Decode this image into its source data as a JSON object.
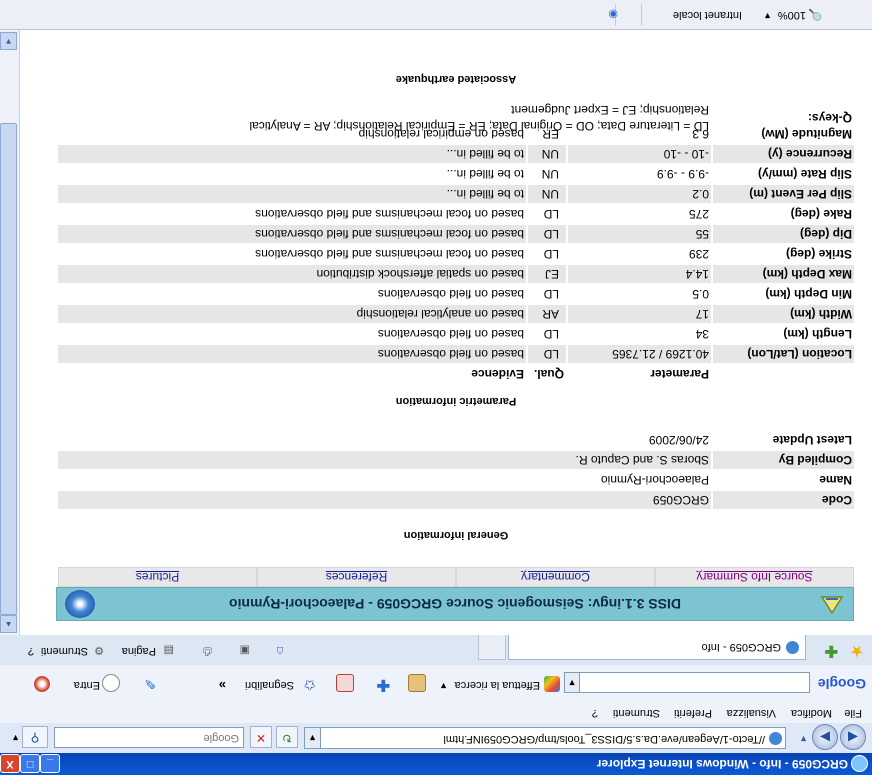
{
  "window": {
    "title": "GRCG059 - Info - Windows Internet Explorer",
    "minimize": "_",
    "maximize": "□",
    "close": "X"
  },
  "address": {
    "url": "//Tecto-1/Aegean/eve.Da.s.5/DISS3_Tools/tmp/GRCG059INF.html",
    "search_placeholder": "Google",
    "go_symbol": "↻",
    "stop_symbol": "✕"
  },
  "menu": [
    "File",
    "Modifica",
    "Visualizza",
    "Preferiti",
    "Strumenti",
    "?"
  ],
  "google_toolbar": {
    "logo": "Google",
    "search_button": "Effettua la ricerca",
    "bookmarks_label": "Segnalibri",
    "more": "»",
    "signin": "Entra"
  },
  "tabs": {
    "active_title": "GRCG059 - Info",
    "commands": {
      "page": "Pagina",
      "tools": "Strumenti"
    }
  },
  "page": {
    "banner_title": "DISS 3.1.ingv: Seismogenic Source GRCG059 - Palaeochori-Rymnio",
    "nav_links": [
      "Source Info Summary",
      "Commentary",
      "References",
      "Pictures"
    ],
    "nav_colors": [
      "#800080",
      "#1b1b9f",
      "#1b1b9f",
      "#1b1b9f"
    ],
    "general_title": "General information",
    "general_rows": [
      {
        "label": "Code",
        "value": "GRCG059"
      },
      {
        "label": "Name",
        "value": "Palaeochori-Rymnio"
      },
      {
        "label": "Compiled By",
        "value": "Sboras S. and Caputo R."
      },
      {
        "label": "Latest Update",
        "value": "24/06/2009"
      }
    ],
    "parametric_title": "Parametric information",
    "param_header": {
      "parameter": "Parameter",
      "qual": "Qual.",
      "evidence": "Evidence"
    },
    "param_rows": [
      {
        "label": "Location (Lat/Lon)",
        "value": "40.1269 / 21.7365",
        "qual": "LD",
        "evidence": "based on field observations"
      },
      {
        "label": "Length (km)",
        "value": "34",
        "qual": "LD",
        "evidence": "based on field observations"
      },
      {
        "label": "Width (km)",
        "value": "17",
        "qual": "AR",
        "evidence": "based on analytical relationship"
      },
      {
        "label": "Min Depth (km)",
        "value": "0.5",
        "qual": "LD",
        "evidence": "based on field observations"
      },
      {
        "label": "Max Depth (km)",
        "value": "14.4",
        "qual": "EJ",
        "evidence": "based on spatial aftershock distribution"
      },
      {
        "label": "Strike (deg)",
        "value": "239",
        "qual": "LD",
        "evidence": "based on focal mechanisms and field observations"
      },
      {
        "label": "Dip (deg)",
        "value": "55",
        "qual": "LD",
        "evidence": "based on focal mechanisms and field observations"
      },
      {
        "label": "Rake (deg)",
        "value": "275",
        "qual": "LD",
        "evidence": "based on focal mechanisms and field observations"
      },
      {
        "label": "Slip Per Event (m)",
        "value": "0.2",
        "qual": "UN",
        "evidence": "to be filled in..."
      },
      {
        "label": "Slip Rate (mm/y)",
        "value": "-9.9 - -9.9",
        "qual": "UN",
        "evidence": "to be filled in..."
      },
      {
        "label": "Recurrence (y)",
        "value": "-10 - -10",
        "qual": "UN",
        "evidence": "to be filled in..."
      },
      {
        "label": "Magnitude (Mw)",
        "value": "6.3",
        "qual": "ER",
        "evidence": "based on empirical relationship"
      }
    ],
    "qkeys_label": "Q-keys:",
    "qkeys_line1": "LD = Literature Data; OD = Original Data; ER = Empirical Relationship; AR = Analytical",
    "qkeys_line2": "Relationship; EJ = Expert Judgement",
    "associated_title": "Associated earthquake"
  },
  "status": {
    "zone": "Intranet locale",
    "zoom": "100%"
  }
}
